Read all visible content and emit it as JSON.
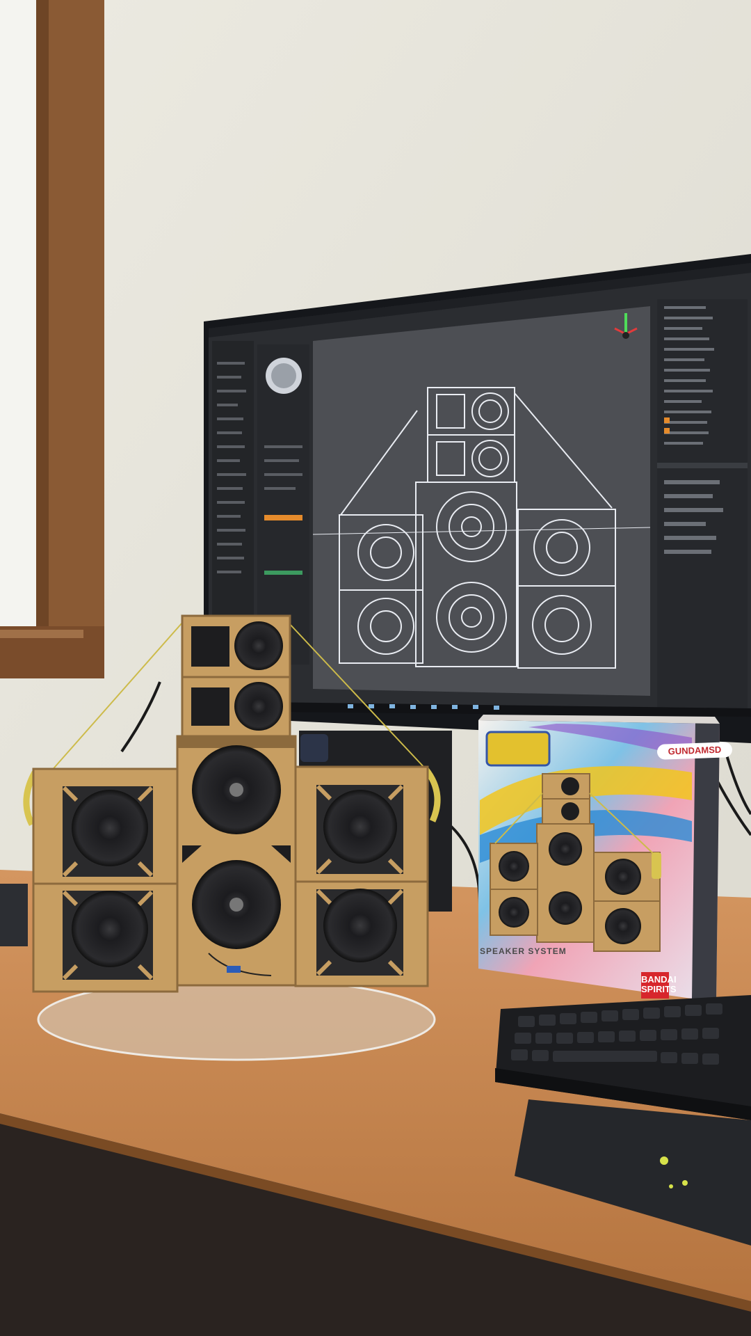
{
  "photo": {
    "palette": {
      "wall": "#e6e4da",
      "window_frame": "#8a5a34",
      "desk": "#c98a52",
      "desk_edge": "#2a2320",
      "wood": "#c79e62",
      "wood_dark": "#8c6a3d",
      "speaker_cone": "#1d1d1f",
      "monitor_bezel": "#15171b",
      "viewport": "#4d4f54",
      "wireframe": "#e9ecf2",
      "panel": "#2b2d31",
      "keyboard": "#1c1d20",
      "mousepad": "#25272b"
    }
  },
  "product_box": {
    "brand_label": "GUNDAMSD",
    "subtitle": "SPEAKER SYSTEM",
    "maker_label": "BANDAI SPIRITS"
  }
}
